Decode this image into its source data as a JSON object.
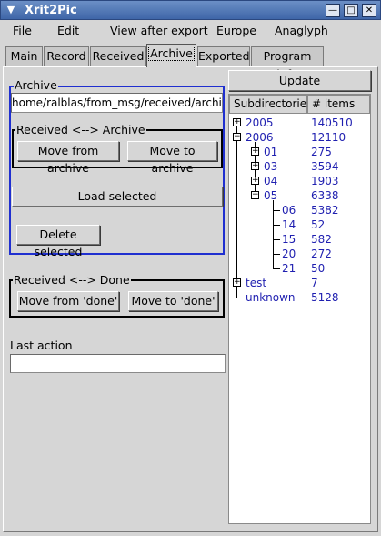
{
  "window": {
    "title": "Xrit2Pic"
  },
  "menu": [
    "File",
    "Edit",
    "View after export",
    "Europe",
    "Anaglyph"
  ],
  "tabs": [
    "Main",
    "Record",
    "Received",
    "Archive",
    "Exported",
    "Program info"
  ],
  "active_tab": "Archive",
  "archive": {
    "group_label": "Archive",
    "path": "home/ralblas/from_msg/received/archive/",
    "received_archive_label": "Received <--> Archive",
    "move_from_archive": "Move from archive",
    "move_to_archive": "Move to archive",
    "load_selected": "Load selected",
    "delete_selected": "Delete selected"
  },
  "done": {
    "group_label": "Received <--> Done",
    "move_from_done": "Move from 'done'",
    "move_to_done": "Move to 'done'"
  },
  "last_action": {
    "label": "Last action",
    "value": ""
  },
  "tree": {
    "update_button": "Update",
    "col_subdir": "Subdirectories",
    "col_items": "# items",
    "nodes": [
      {
        "name": "2005",
        "count": "140510"
      },
      {
        "name": "2006",
        "count": "12110"
      },
      {
        "name": "01",
        "count": "275"
      },
      {
        "name": "03",
        "count": "3594"
      },
      {
        "name": "04",
        "count": "1903"
      },
      {
        "name": "05",
        "count": "6338"
      },
      {
        "name": "06",
        "count": "5382"
      },
      {
        "name": "14",
        "count": "52"
      },
      {
        "name": "15",
        "count": "582"
      },
      {
        "name": "20",
        "count": "272"
      },
      {
        "name": "21",
        "count": "50"
      },
      {
        "name": "test",
        "count": "7"
      },
      {
        "name": "unknown",
        "count": "5128"
      }
    ]
  },
  "icons": {
    "window_menu": "chevron-down-icon",
    "minimize": "minimize-icon",
    "maximize": "maximize-icon",
    "close": "close-icon"
  },
  "colors": {
    "titlebar": "#4a72b4",
    "tree_text": "#1f1fb0",
    "archive_frame": "#1f2fd0"
  }
}
